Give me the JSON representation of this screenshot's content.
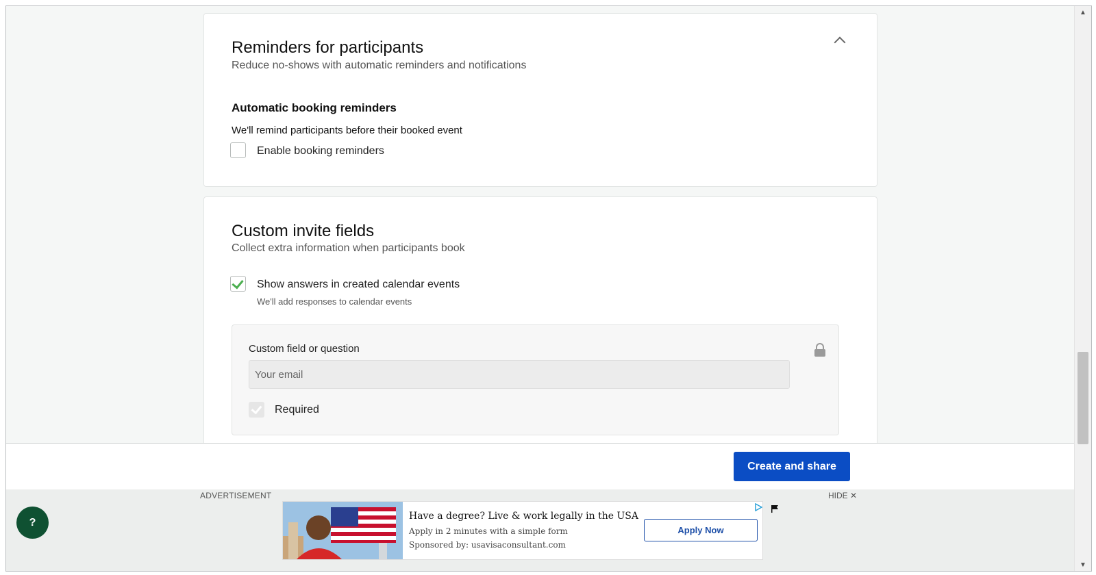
{
  "reminders_card": {
    "title": "Reminders for participants",
    "subtitle": "Reduce no-shows with automatic reminders and notifications",
    "section_title": "Automatic booking reminders",
    "section_desc": "We'll remind participants before their booked event",
    "enable_label": "Enable booking reminders",
    "enable_checked": false
  },
  "custom_fields_card": {
    "title": "Custom invite fields",
    "subtitle": "Collect extra information when participants book",
    "show_answers_label": "Show answers in created calendar events",
    "show_answers_hint": "We'll add responses to calendar events",
    "show_answers_checked": true,
    "field_label": "Custom field or question",
    "field_value": "Your email",
    "required_label": "Required",
    "required_checked": true
  },
  "footer": {
    "cta_label": "Create and share"
  },
  "ad": {
    "label": "ADVERTISEMENT",
    "hide_label": "HIDE ✕",
    "headline": "Have a degree? Live & work legally in the USA",
    "line2": "Apply in 2 minutes with a simple form",
    "line3": "Sponsored by: usavisaconsultant.com",
    "button_label": "Apply Now"
  },
  "help": {
    "label": "?"
  },
  "colors": {
    "primary": "#0b4dc4",
    "help_button": "#0f5132",
    "check_green": "#4caf50"
  }
}
